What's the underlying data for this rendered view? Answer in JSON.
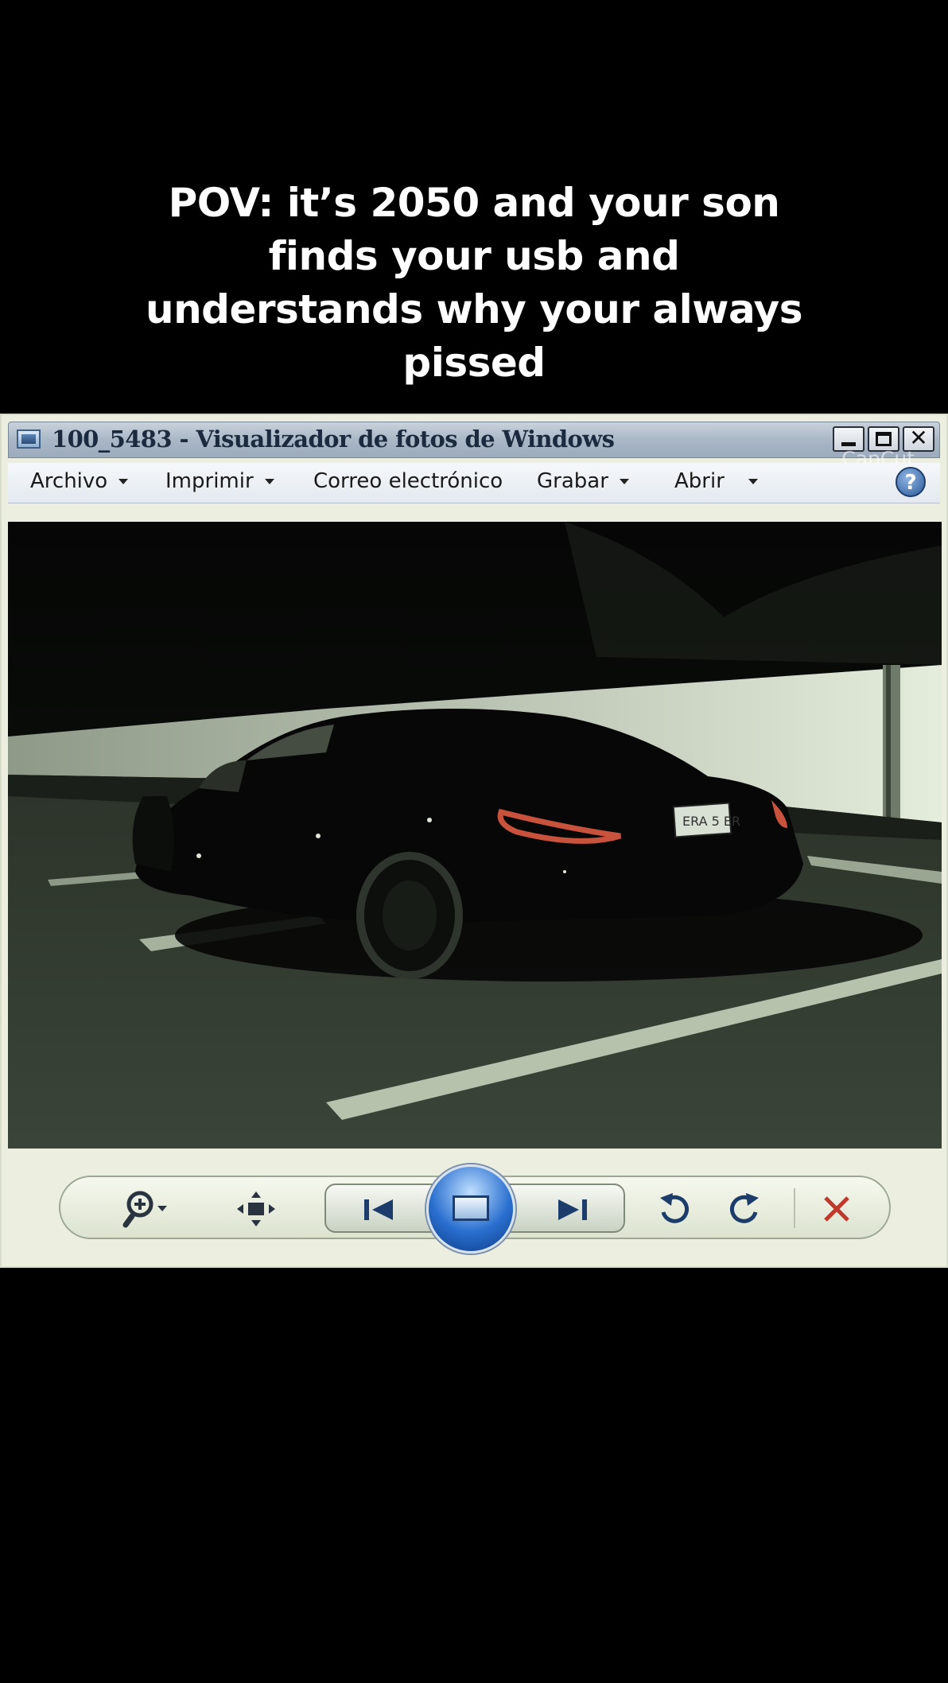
{
  "caption": {
    "line1": "POV: it’s 2050 and your son",
    "line2": "finds your usb and",
    "line3": "understands why your always",
    "line4": "pissed"
  },
  "window": {
    "title": "100_5483 - Visualizador de fotos de Windows",
    "watermark": "CapCut"
  },
  "menu": {
    "archivo": "Archivo",
    "imprimir": "Imprimir",
    "correo": "Correo electrónico",
    "grabar": "Grabar",
    "abrir": "Abrir",
    "help": "?"
  },
  "photo": {
    "subject": "dark car parked at night",
    "plate_text": "ERA 5 ER"
  },
  "colors": {
    "close_red": "#c0392b",
    "accent_blue": "#2a6fcf"
  },
  "icons": [
    "window-app-icon",
    "minimize-icon",
    "maximize-icon",
    "close-icon",
    "help-icon",
    "zoom-icon",
    "fit-window-icon",
    "previous-icon",
    "slideshow-icon",
    "next-icon",
    "rotate-ccw-icon",
    "rotate-cw-icon",
    "delete-icon"
  ]
}
